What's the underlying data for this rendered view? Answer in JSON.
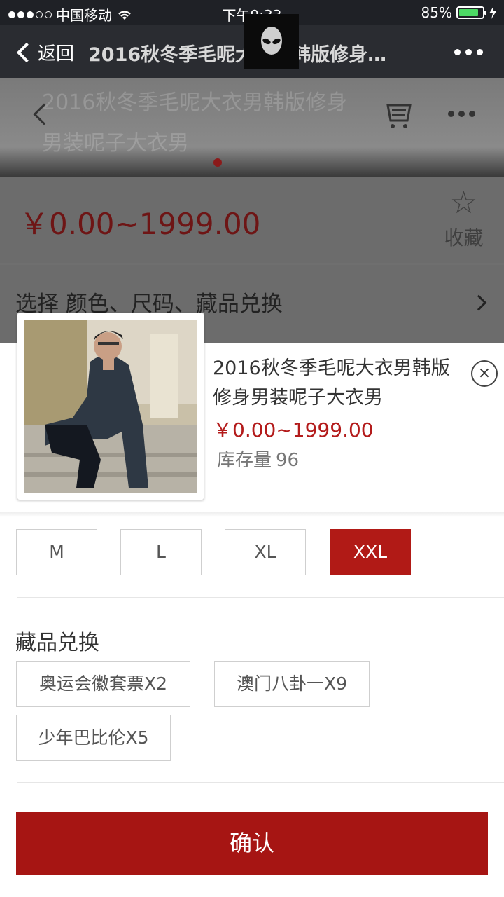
{
  "status_bar": {
    "carrier": "中国移动",
    "time": "下午9:33",
    "battery_text": "85%",
    "battery_level": 0.85,
    "icons": [
      "signal-dots-icon",
      "wifi-icon",
      "battery-icon",
      "charging-icon"
    ]
  },
  "nav": {
    "back_label": "返回",
    "title": "2016秋冬季毛呢大衣男韩版修身…",
    "icons": [
      "chevron-left-icon",
      "alien-logo-icon",
      "more-icon"
    ]
  },
  "background_page": {
    "banner_text": "2016秋冬季毛呢大衣男韩版修身男装呢子大衣男",
    "price": "￥0.00~1999.00",
    "favorite_label": "收藏",
    "select_text": "选择 颜色、尺码、藏品兑换",
    "icons": [
      "back-icon",
      "cart-icon",
      "more-icon",
      "star-icon",
      "chevron-right-icon"
    ]
  },
  "product": {
    "name": "2016秋冬季毛呢大衣男韩版修身男装呢子大衣男",
    "price": "￥0.00~1999.00",
    "stock_label": "库存量",
    "stock_value": "96",
    "close_glyph": "×"
  },
  "sizes": {
    "options": [
      "M",
      "L",
      "XL",
      "XXL"
    ],
    "selected": "XXL"
  },
  "collectibles": {
    "title": "藏品兑换",
    "options": [
      "奥运会徽套票X2",
      "澳门八卦一X9",
      "少年巴比伦X5"
    ]
  },
  "confirm_label": "确认",
  "colors": {
    "accent": "#b11a16",
    "price_red": "#b31b1b",
    "confirm_bg": "#a61513",
    "nav_bg": "#2a2c31"
  }
}
